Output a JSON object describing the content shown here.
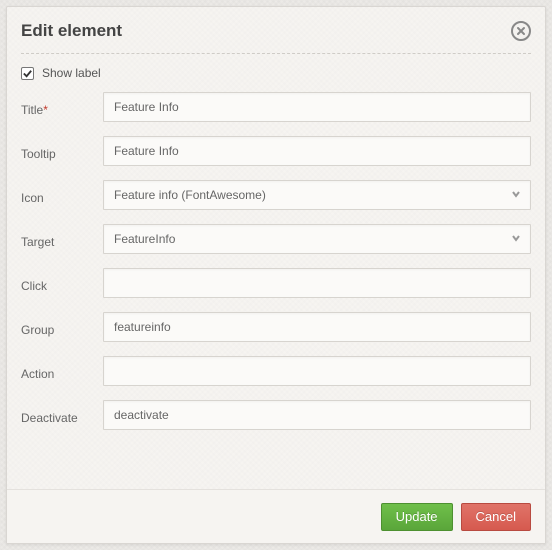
{
  "dialog": {
    "title": "Edit element"
  },
  "showLabel": {
    "label": "Show label",
    "checked": true
  },
  "fields": {
    "title": {
      "label": "Title",
      "required": true,
      "value": "Feature Info"
    },
    "tooltip": {
      "label": "Tooltip",
      "required": false,
      "value": "Feature Info"
    },
    "icon": {
      "label": "Icon",
      "required": false,
      "value": "Feature info (FontAwesome)"
    },
    "target": {
      "label": "Target",
      "required": false,
      "value": "FeatureInfo"
    },
    "click": {
      "label": "Click",
      "required": false,
      "value": ""
    },
    "group": {
      "label": "Group",
      "required": false,
      "value": "featureinfo"
    },
    "action": {
      "label": "Action",
      "required": false,
      "value": ""
    },
    "deactivate": {
      "label": "Deactivate",
      "required": false,
      "value": "deactivate"
    }
  },
  "buttons": {
    "update": "Update",
    "cancel": "Cancel"
  }
}
